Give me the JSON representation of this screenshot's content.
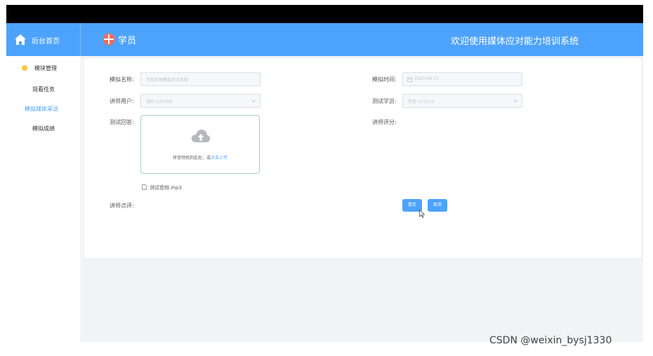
{
  "header": {
    "home_label": "后台首页",
    "user_label": "学员",
    "system_title": "欢迎使用媒体应对能力培训系统"
  },
  "sidebar": {
    "items": [
      {
        "label": "模块管理"
      },
      {
        "label": "观看任务"
      },
      {
        "label": "模拟媒体采访",
        "active": true
      },
      {
        "label": "模拟成绩"
      }
    ]
  },
  "form": {
    "name_label": "模拟名称:",
    "name_placeholder": "可按右键模拟采访名称",
    "time_label": "模拟时间:",
    "time_value": "2023-04-21",
    "teacher_user_label": "讲师用户:",
    "teacher_user_value": "讲师-123456",
    "student_label": "测试学员:",
    "student_value": "学员-123123",
    "answer_label": "测试回答:",
    "teacher_score_label": "讲师评分:",
    "upload_text": "将音频拖到此处，或",
    "upload_link": "点击上传",
    "file_name": "测试音频.mp3",
    "comment_label": "讲师点评:"
  },
  "buttons": {
    "submit": "提交",
    "cancel": "取消"
  },
  "watermark": "CSDN @weixin_bysj1330",
  "colors": {
    "accent": "#4da3fb",
    "topbar": "#000000",
    "content_bg": "#f2f3f5"
  }
}
